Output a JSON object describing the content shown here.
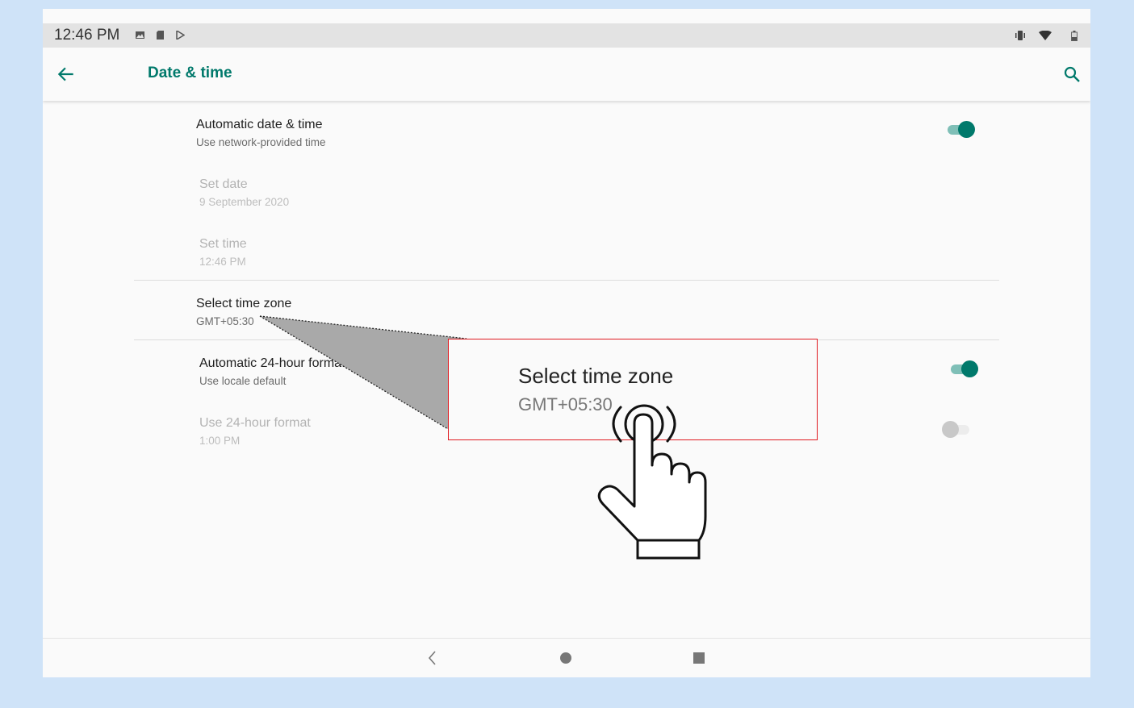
{
  "statusbar": {
    "time": "12:46 PM",
    "left_icons": [
      "image-icon",
      "sd-card-icon",
      "play-store-icon"
    ],
    "right_icons": [
      "vibrate-icon",
      "wifi-icon",
      "battery-icon"
    ]
  },
  "appbar": {
    "title": "Date & time",
    "title_color": "#00796b"
  },
  "settings": [
    {
      "title": "Automatic date & time",
      "summary": "Use network-provided time",
      "toggle": true,
      "enabled": true
    },
    {
      "title": "Set date",
      "summary": "9 September 2020",
      "enabled": false
    },
    {
      "title": "Set time",
      "summary": "12:46 PM",
      "enabled": false
    },
    {
      "title": "Select time zone",
      "summary": "GMT+05:30",
      "enabled": true
    },
    {
      "title": "Automatic 24-hour format",
      "summary": "Use locale default",
      "toggle": true,
      "enabled": true
    },
    {
      "title": "Use 24-hour format",
      "summary": "1:00 PM",
      "toggle": false,
      "enabled": false
    }
  ],
  "callout": {
    "title": "Select time zone",
    "summary": "GMT+05:30",
    "border_color": "#e0191f"
  },
  "navbar": {
    "icons": [
      "back-triangle-icon",
      "home-circle-icon",
      "recents-square-icon"
    ]
  }
}
